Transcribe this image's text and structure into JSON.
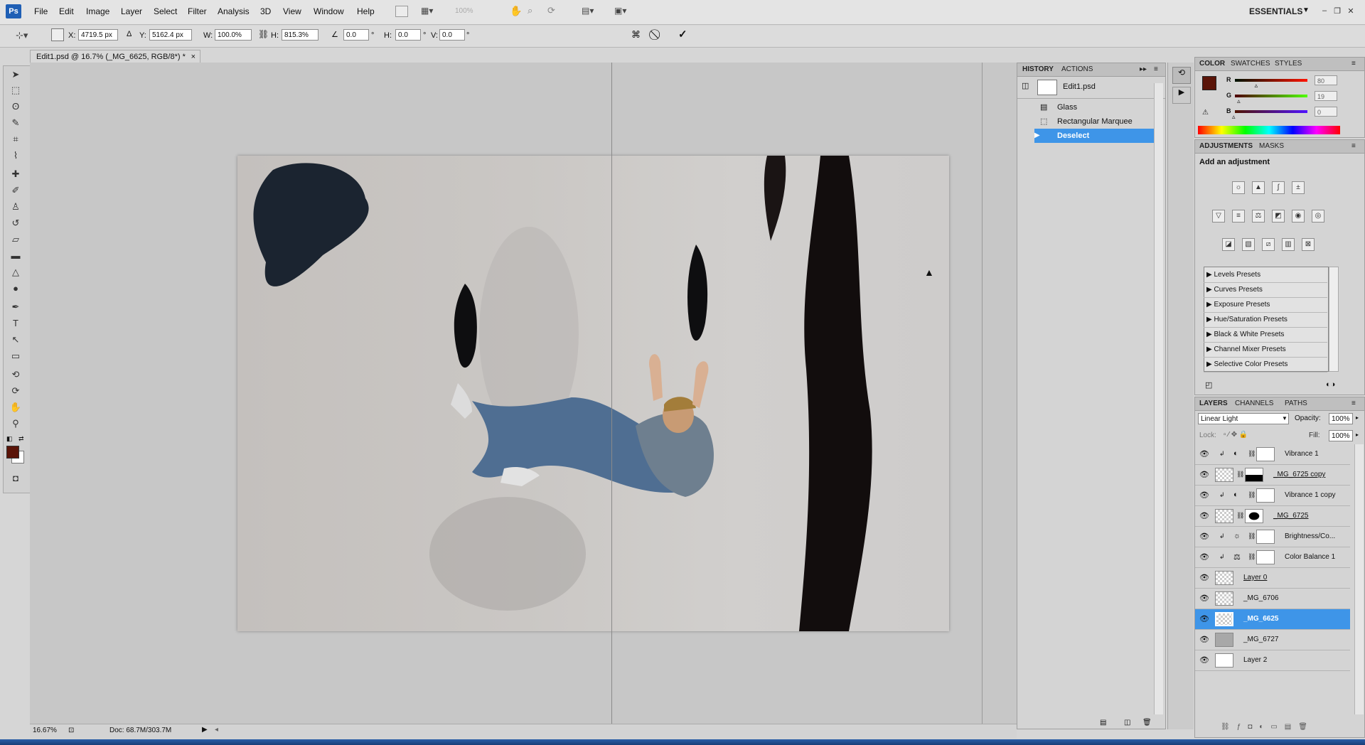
{
  "app": {
    "logo": "Ps",
    "menus": [
      "File",
      "Edit",
      "Image",
      "Layer",
      "Select",
      "Filter",
      "Analysis",
      "3D",
      "View",
      "Window",
      "Help"
    ],
    "zoom_box": "100%",
    "workspace": "ESSENTIALS"
  },
  "options": {
    "x_label": "X:",
    "x": "4719.5 px",
    "y_label": "Y:",
    "y": "5162.4 px",
    "w_label": "W:",
    "w": "100.0%",
    "h_label": "H:",
    "h": "815.3%",
    "angle": "0.0",
    "hskew_label": "H:",
    "hskew": "0.0",
    "vskew_label": "V:",
    "vskew": "0.0",
    "deg": "°"
  },
  "document": {
    "tab_title": "Edit1.psd @ 16.7% (_MG_6625, RGB/8*) *",
    "zoom": "16.67%",
    "doc_info": "Doc: 68.7M/303.7M"
  },
  "history": {
    "tabs": [
      "HISTORY",
      "ACTIONS"
    ],
    "snapshot": "Edit1.psd",
    "items": [
      "Glass",
      "Rectangular Marquee",
      "Deselect"
    ]
  },
  "color": {
    "tabs": [
      "COLOR",
      "SWATCHES",
      "STYLES"
    ],
    "r_label": "R",
    "g_label": "G",
    "b_label": "B",
    "r": "80",
    "g": "19",
    "b": "0",
    "foreground": "#5a1408",
    "r_level": 0.31,
    "g_level": 0.07,
    "b_level": 0.0
  },
  "adjustments": {
    "tabs": [
      "ADJUSTMENTS",
      "MASKS"
    ],
    "heading": "Add an adjustment",
    "presets": [
      "Levels Presets",
      "Curves Presets",
      "Exposure Presets",
      "Hue/Saturation Presets",
      "Black & White Presets",
      "Channel Mixer Presets",
      "Selective Color Presets"
    ]
  },
  "layers": {
    "tabs": [
      "LAYERS",
      "CHANNELS",
      "PATHS"
    ],
    "blend_mode": "Linear Light",
    "opacity_label": "Opacity:",
    "opacity": "100%",
    "lock_label": "Lock:",
    "fill_label": "Fill:",
    "fill": "100%",
    "items": [
      "Vibrance 1",
      "_MG_6725 copy",
      "Vibrance 1 copy",
      "_MG_6725",
      "Brightness/Co...",
      "Color Balance 1",
      "Layer 0",
      "_MG_6706",
      "_MG_6625",
      "_MG_6727",
      "Layer 2"
    ]
  }
}
